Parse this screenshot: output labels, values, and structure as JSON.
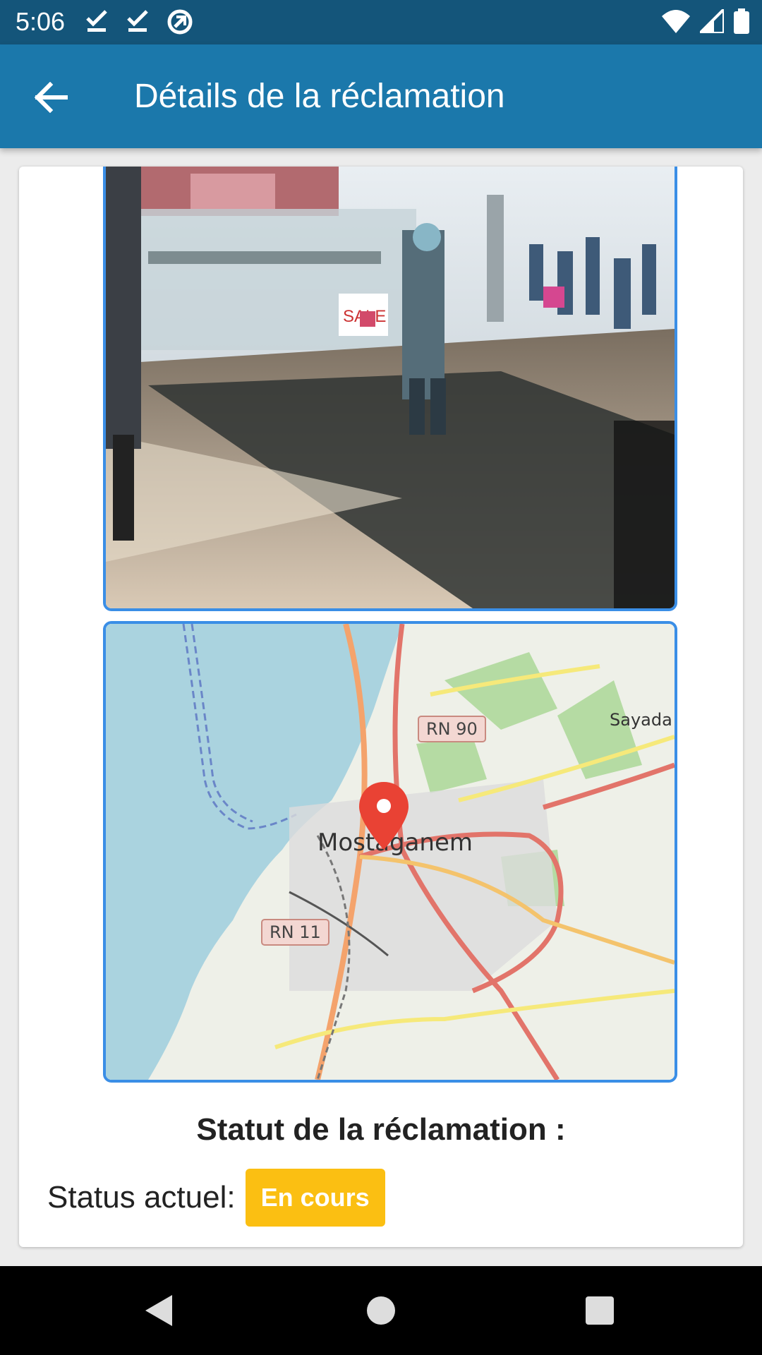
{
  "status_bar": {
    "time": "5:06",
    "left_icons": [
      "download-done-icon",
      "download-done-icon",
      "sync-icon"
    ],
    "right_icons": [
      "wifi-icon",
      "cell-signal-icon",
      "battery-icon"
    ]
  },
  "app_bar": {
    "title": "Détails de la réclamation",
    "background": "#1b78ab"
  },
  "map": {
    "city_label": "Mostaganem",
    "town_label": "Sayada",
    "road_labels": [
      "RN 90",
      "RN 11"
    ]
  },
  "status_section": {
    "title": "Statut de la réclamation :",
    "label": "Status actuel:",
    "badge": "En cours",
    "badge_color": "#fbbf12"
  },
  "nav_bar": {
    "icons": [
      "back-triangle-icon",
      "home-circle-icon",
      "recents-square-icon"
    ]
  }
}
